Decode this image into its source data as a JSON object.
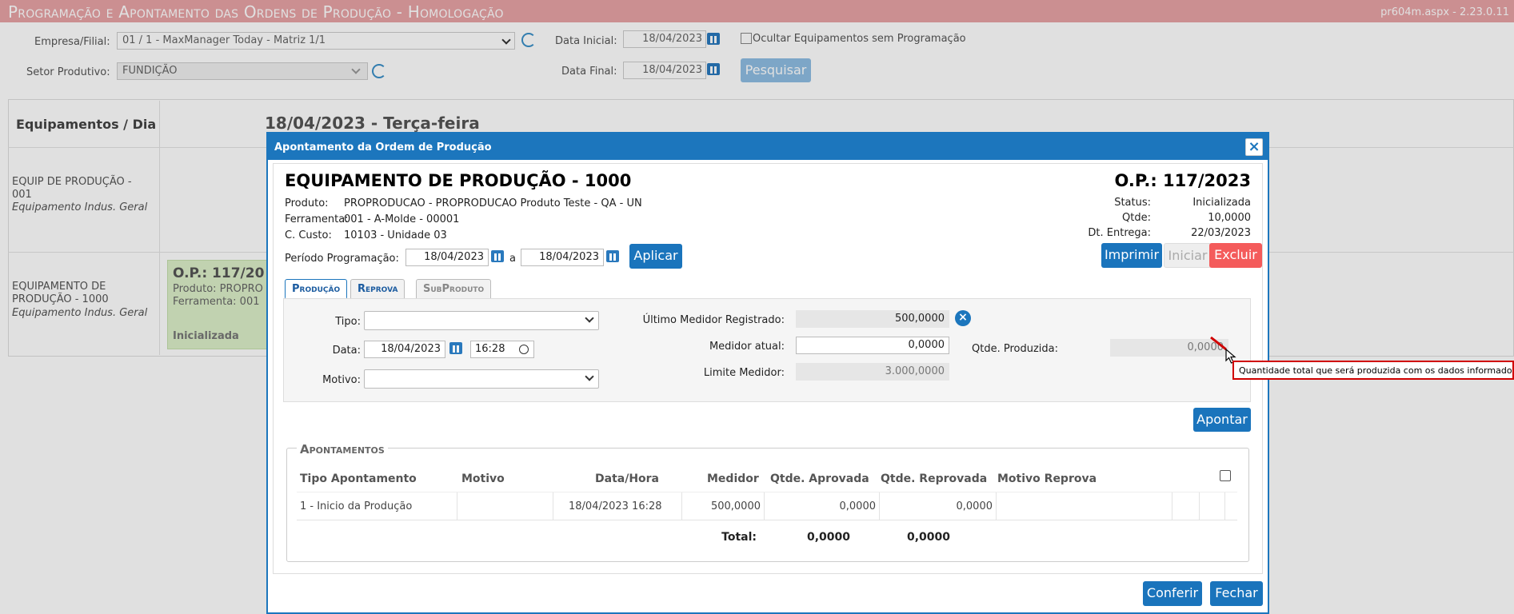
{
  "header": {
    "title": "Programação e Apontamento das Ordens de Produção  - Homologação",
    "version": "pr604m.aspx - 2.23.0.11"
  },
  "filters": {
    "empresa_label": "Empresa/Filial:",
    "empresa_value": "01 / 1 - MaxManager Today - Matriz 1/1",
    "setor_label": "Setor Produtivo:",
    "setor_value": "FUNDIÇÃO",
    "data_inicial_label": "Data Inicial:",
    "data_inicial_value": "18/04/2023",
    "data_final_label": "Data Final:",
    "data_final_value": "18/04/2023",
    "ocultar_label": "Ocultar Equipamentos sem Programação",
    "pesquisar_label": "Pesquisar"
  },
  "schedule": {
    "col_header": "Equipamentos / Dia",
    "day_header": "18/04/2023 - Terça-feira",
    "rows": [
      {
        "name": "EQUIP DE PRODUÇÃO - 001",
        "sub": "Equipamento Indus. Geral"
      },
      {
        "name": "EQUIPAMENTO DE PRODUÇÃO - 1000",
        "sub": "Equipamento Indus. Geral"
      }
    ],
    "card": {
      "op": "O.P.: 117/20",
      "produto": "Produto: PROPRO",
      "ferramenta": "Ferramenta: 001",
      "status": "Inicializada"
    }
  },
  "modal": {
    "title": "Apontamento da Ordem de Produção",
    "equipamento": "EQUIPAMENTO DE PRODUÇÃO - 1000",
    "op": "O.P.: 117/2023",
    "produto_label": "Produto:",
    "produto_value": "PROPRODUCAO - PROPRODUCAO Produto Teste - QA - UN",
    "ferramenta_label": "Ferramenta:",
    "ferramenta_value": "001 - A-Molde - 00001",
    "custo_label": "C. Custo:",
    "custo_value": "10103 - Unidade 03",
    "status_label": "Status:",
    "status_value": "Inicializada",
    "qtde_label": "Qtde:",
    "qtde_value": "10,0000",
    "entrega_label": "Dt. Entrega:",
    "entrega_value": "22/03/2023",
    "periodo_label": "Período Programação:",
    "periodo_inicio": "18/04/2023",
    "periodo_sep": "a",
    "periodo_fim": "18/04/2023",
    "aplicar_label": "Aplicar",
    "imprimir_label": "Imprimir",
    "iniciar_label": "Iniciar",
    "excluir_label": "Excluir",
    "tabs": [
      {
        "label": "Produção"
      },
      {
        "label": "Reprova"
      },
      {
        "label": "SubProduto"
      }
    ],
    "form": {
      "tipo_label": "Tipo:",
      "data_label": "Data:",
      "data_value": "18/04/2023",
      "hora_value": "16:28",
      "motivo_label": "Motivo:",
      "ultimo_label": "Último Medidor Registrado:",
      "ultimo_value": "500,0000",
      "atual_label": "Medidor atual:",
      "atual_value": "0,0000",
      "limite_label": "Limite Medidor:",
      "limite_value": "3.000,0000",
      "qtde_prod_label": "Qtde. Produzida:",
      "qtde_prod_value": "0,0000"
    },
    "tooltip": "Quantidade total que será produzida com os dados informados",
    "apontar_label": "Apontar",
    "apontamentos": {
      "legend": "Apontamentos",
      "columns": [
        "Tipo Apontamento",
        "Motivo",
        "Data/Hora",
        "Medidor",
        "Qtde. Aprovada",
        "Qtde. Reprovada",
        "Motivo Reprova"
      ],
      "rows": [
        {
          "tipo": "1 - Inicio da Produção",
          "motivo": "",
          "datahora": "18/04/2023 16:28",
          "medidor": "500,0000",
          "aprovada": "0,0000",
          "reprovada": "0,0000",
          "motivo_reprova": ""
        }
      ],
      "total_label": "Total:",
      "total_aprovada": "0,0000",
      "total_reprovada": "0,0000"
    },
    "conferir_label": "Conferir",
    "fechar_label": "Fechar"
  }
}
